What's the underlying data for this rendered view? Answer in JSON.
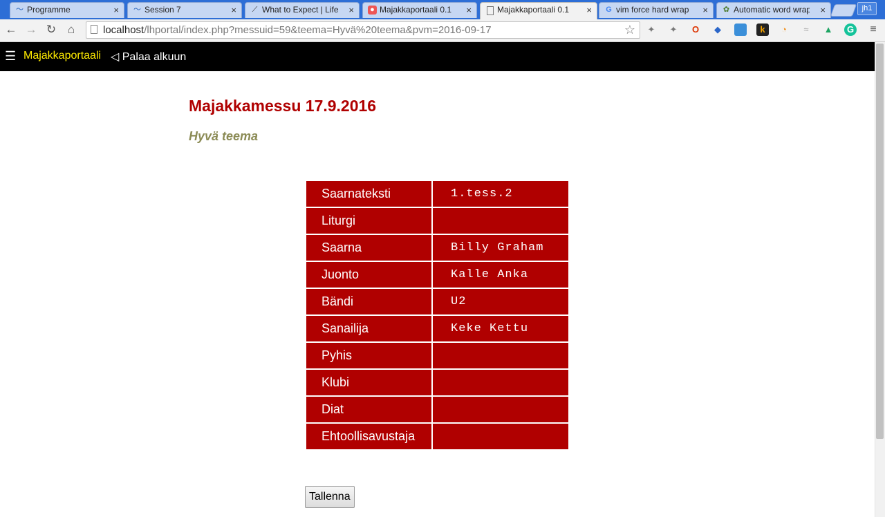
{
  "browser": {
    "tabs": [
      {
        "title": "Programme",
        "icon": "wave-icon"
      },
      {
        "title": "Session 7",
        "icon": "wave-icon"
      },
      {
        "title": "What to Expect | Life",
        "icon": "logo-icon"
      },
      {
        "title": "Majakkaportaali 0.1",
        "icon": "app-icon"
      },
      {
        "title": "Majakkaportaali 0.1",
        "icon": "page-icon",
        "active": true
      },
      {
        "title": "vim force hard wrap",
        "icon": "google-icon"
      },
      {
        "title": "Automatic word wrap",
        "icon": "gear-icon"
      }
    ],
    "profile": "jh1",
    "url_host": "localhost",
    "url_rest": "/lhportal/index.php?messuid=59&teema=Hyvä%20teema&pvm=2016-09-17"
  },
  "site": {
    "brand": "Majakkaportaali",
    "back_link": "◁ Palaa alkuun"
  },
  "page": {
    "title": "Majakkamessu 17.9.2016",
    "theme": "Hyvä teema"
  },
  "roles": [
    {
      "label": "Saarnateksti",
      "value": "1.tess.2"
    },
    {
      "label": "Liturgi",
      "value": ""
    },
    {
      "label": "Saarna",
      "value": "Billy Graham"
    },
    {
      "label": "Juonto",
      "value": "Kalle Anka"
    },
    {
      "label": "Bändi",
      "value": "U2"
    },
    {
      "label": "Sanailija",
      "value": "Keke Kettu"
    },
    {
      "label": "Pyhis",
      "value": ""
    },
    {
      "label": "Klubi",
      "value": ""
    },
    {
      "label": "Diat",
      "value": ""
    },
    {
      "label": "Ehtoollisavustaja",
      "value": ""
    }
  ],
  "save_button": "Tallenna",
  "colors": {
    "accent": "#b00000",
    "brand": "#ffeb00",
    "theme": "#8b8b55"
  }
}
